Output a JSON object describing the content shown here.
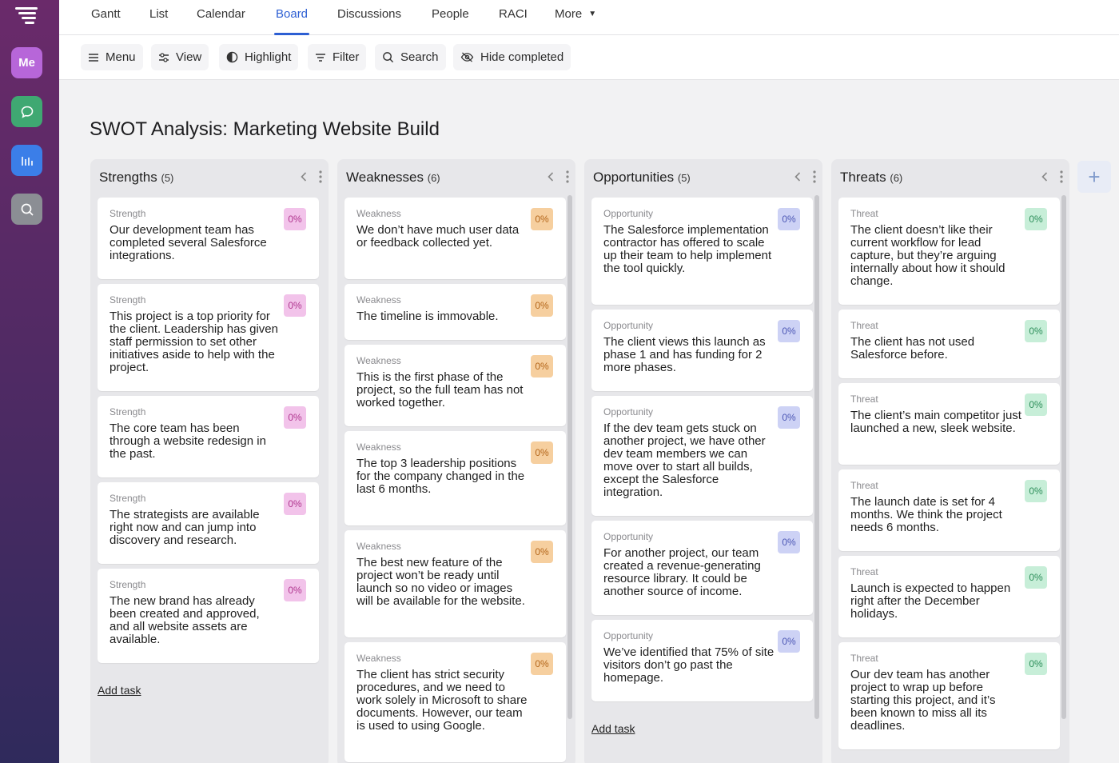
{
  "rail": {
    "me_label": "Me",
    "icons": [
      "logo-icon",
      "chat-icon",
      "reports-icon",
      "search-icon"
    ]
  },
  "nav": {
    "tabs": [
      {
        "label": "Gantt"
      },
      {
        "label": "List"
      },
      {
        "label": "Calendar"
      },
      {
        "label": "Board",
        "active": true
      },
      {
        "label": "Discussions"
      },
      {
        "label": "People"
      },
      {
        "label": "RACI"
      },
      {
        "label": "More"
      }
    ]
  },
  "toolbar": {
    "menu": "Menu",
    "view": "View",
    "highlight": "Highlight",
    "filter": "Filter",
    "search": "Search",
    "hide_completed": "Hide completed"
  },
  "page": {
    "title": "SWOT Analysis: Marketing Website Build"
  },
  "colors": {
    "accent": "#2d5fd3",
    "strength_badge": "#f2c3ea",
    "weakness_badge": "#f6cf9f",
    "opportunity_badge": "#cdd2f5",
    "threat_badge": "#c7eed8"
  },
  "board": {
    "add_task_label": "Add task",
    "columns": [
      {
        "title": "Strengths",
        "count": "(5)",
        "cards": [
          {
            "type": "Strength",
            "text": "Our development team has completed several Salesforce integrations.",
            "progress": "0%"
          },
          {
            "type": "Strength",
            "text": "This project is a top priority for the client. Leadership has given staff permission to set other initiatives aside to help with the project.",
            "progress": "0%"
          },
          {
            "type": "Strength",
            "text": "The core team has been through a website redesign in the past.",
            "progress": "0%"
          },
          {
            "type": "Strength",
            "text": "The strategists are available right now and can jump into discovery and research.",
            "progress": "0%"
          },
          {
            "type": "Strength",
            "text": "The new brand has already been created and approved, and all website assets are available.",
            "progress": "0%"
          }
        ]
      },
      {
        "title": "Weaknesses",
        "count": "(6)",
        "cards": [
          {
            "type": "Weakness",
            "text": "We don’t have much user data or feedback collected yet.",
            "progress": "0%"
          },
          {
            "type": "Weakness",
            "text": "The timeline is immovable.",
            "progress": "0%"
          },
          {
            "type": "Weakness",
            "text": "This is the first phase of the project, so the full team has not worked together.",
            "progress": "0%"
          },
          {
            "type": "Weakness",
            "text": "The top 3 leadership positions for the company changed in the last 6 months.",
            "progress": "0%"
          },
          {
            "type": "Weakness",
            "text": "The best new feature of the project won’t be ready until launch so no video or images will be available for the website.",
            "progress": "0%"
          },
          {
            "type": "Weakness",
            "text": "The client has strict security procedures, and we need to work solely in Microsoft to share documents. However, our team is used to using Google.",
            "progress": "0%"
          }
        ]
      },
      {
        "title": "Opportunities",
        "count": "(5)",
        "cards": [
          {
            "type": "Opportunity",
            "text": "The Salesforce implementation contractor has offered to scale up their team to help implement the tool quickly.",
            "progress": "0%"
          },
          {
            "type": "Opportunity",
            "text": "The client views this launch as phase 1 and has funding for 2 more phases.",
            "progress": "0%"
          },
          {
            "type": "Opportunity",
            "text": "If the dev team gets stuck on another project, we have other dev team members we can move over to start all builds, except the Salesforce integration.",
            "progress": "0%"
          },
          {
            "type": "Opportunity",
            "text": "For another project, our team created a revenue-generating resource library. It could be another source of income.",
            "progress": "0%"
          },
          {
            "type": "Opportunity",
            "text": "We’ve identified that 75% of site visitors don’t go past the homepage.",
            "progress": "0%"
          }
        ]
      },
      {
        "title": "Threats",
        "count": "(6)",
        "cards": [
          {
            "type": "Threat",
            "text": "The client doesn’t like their current workflow for lead capture, but they’re arguing internally about how it should change.",
            "progress": "0%"
          },
          {
            "type": "Threat",
            "text": "The client has not used Salesforce before.",
            "progress": "0%"
          },
          {
            "type": "Threat",
            "text": "The client’s main competitor just launched a new, sleek website.",
            "progress": "0%"
          },
          {
            "type": "Threat",
            "text": "The launch date is set for 4 months. We think the project needs 6 months.",
            "progress": "0%"
          },
          {
            "type": "Threat",
            "text": "Launch is expected to happen right after the December holidays.",
            "progress": "0%"
          },
          {
            "type": "Threat",
            "text": "Our dev team has another project to wrap up before starting this project, and it’s been known to miss all its deadlines.",
            "progress": "0%"
          }
        ]
      }
    ]
  }
}
